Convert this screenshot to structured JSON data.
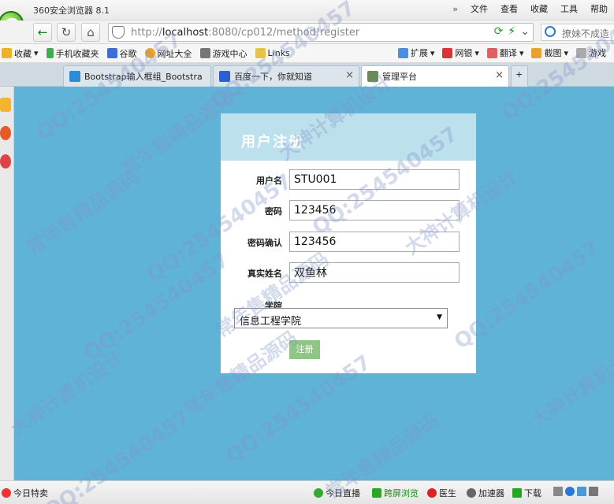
{
  "browser": {
    "title": "360安全浏览器 8.1",
    "menu": [
      "»",
      "文件",
      "查看",
      "收藏",
      "工具",
      "帮助"
    ],
    "address_url_prefix": "http://",
    "address_url_host": "localhost",
    "address_url_rest": ":8080/cp012/method!register",
    "search_placeholder": "撩妹不成造"
  },
  "bookmarks": {
    "left": [
      "收藏",
      "手机收藏夹",
      "谷歌",
      "网址大全",
      "游戏中心",
      "Links"
    ],
    "right": [
      "扩展",
      "网银",
      "翻译",
      "截图",
      "游戏"
    ]
  },
  "tabs": [
    {
      "label": "Bootstrap输入框组_Bootstra",
      "active": false
    },
    {
      "label": "百度一下，你就知道",
      "active": false
    },
    {
      "label": "管理平台",
      "active": true
    }
  ],
  "form": {
    "title": "用户注册",
    "username_label": "用户名",
    "username_value": "STU001",
    "password_label": "密码",
    "password_value": "123456",
    "confirm_label": "密码确认",
    "confirm_value": "123456",
    "realname_label": "真实姓名",
    "realname_value": "双鱼林",
    "college_label": "学院",
    "college_value": "信息工程学院",
    "submit_label": "注册"
  },
  "statusbar": [
    "今日特卖",
    "今日直播",
    "跨屏浏览",
    "医生",
    "加速器",
    "下载"
  ],
  "watermark": [
    "常年售精品源码",
    "QQ:254540457",
    "大神计算机设计"
  ]
}
